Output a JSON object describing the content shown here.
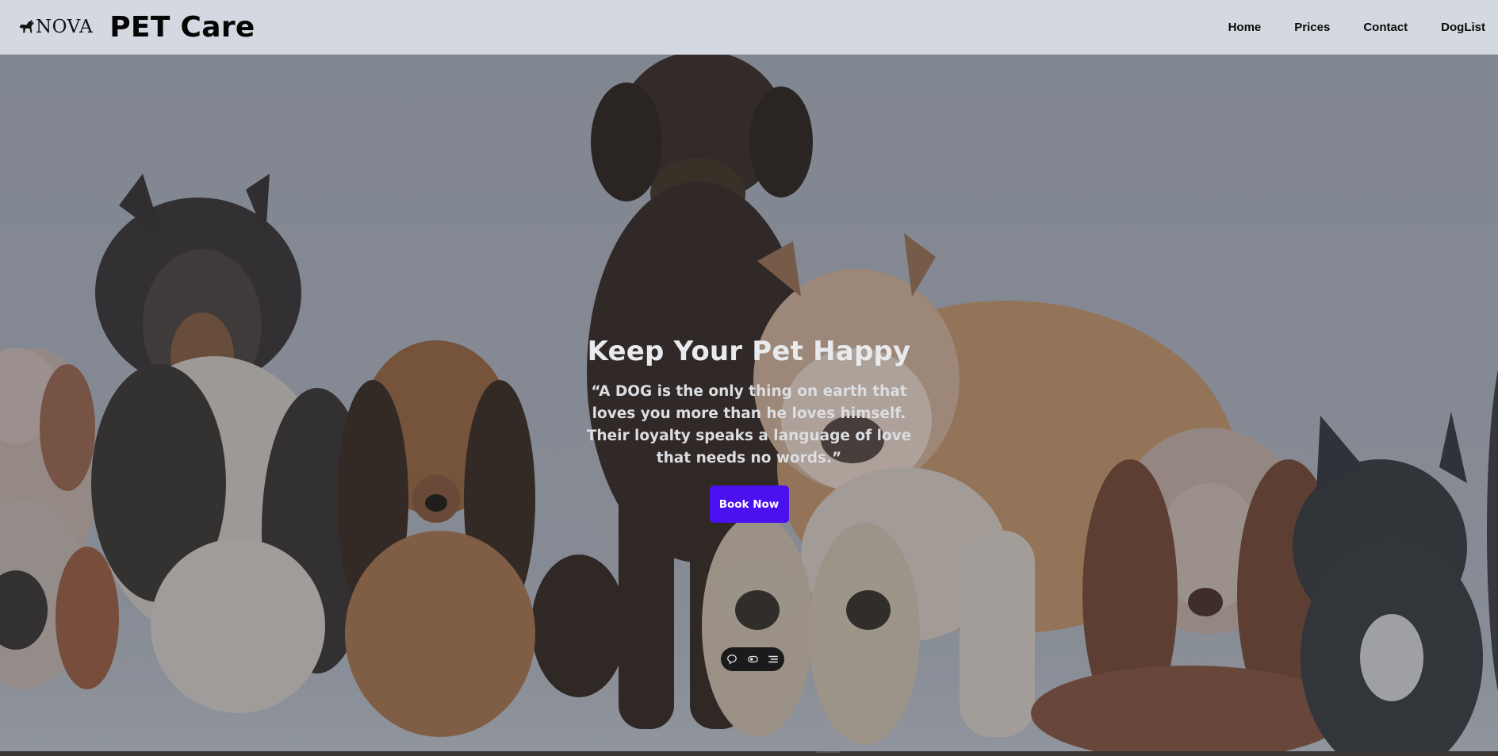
{
  "header": {
    "logo_text": "NOVA",
    "site_title": "PET Care",
    "nav": [
      {
        "label": "Home"
      },
      {
        "label": "Prices"
      },
      {
        "label": "Contact"
      },
      {
        "label": "DogList"
      }
    ]
  },
  "hero": {
    "title": "Keep Your Pet Happy",
    "quote": "“A DOG is the only thing on earth that loves you more than he loves himself. Their loyalty speaks a language of love that needs no words.”",
    "cta_label": "Book Now"
  },
  "toolbar": {
    "icons": [
      "chat-bubble-icon",
      "eye-toggle-icon",
      "menu-lines-icon"
    ]
  },
  "colors": {
    "navbar_bg": "#d4d8e0",
    "accent_button": "#4a10ef",
    "hero_text": "#e9eaee"
  }
}
